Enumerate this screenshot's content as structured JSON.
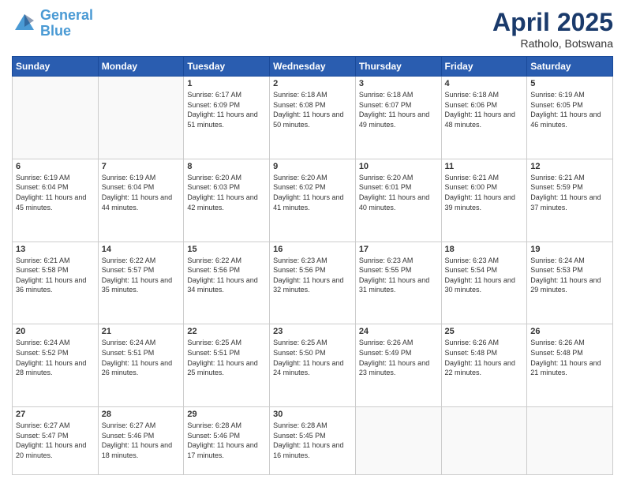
{
  "logo": {
    "line1": "General",
    "line2": "Blue"
  },
  "title": "April 2025",
  "subtitle": "Ratholo, Botswana",
  "days_header": [
    "Sunday",
    "Monday",
    "Tuesday",
    "Wednesday",
    "Thursday",
    "Friday",
    "Saturday"
  ],
  "weeks": [
    [
      {
        "day": "",
        "info": ""
      },
      {
        "day": "",
        "info": ""
      },
      {
        "day": "1",
        "info": "Sunrise: 6:17 AM\nSunset: 6:09 PM\nDaylight: 11 hours and 51 minutes."
      },
      {
        "day": "2",
        "info": "Sunrise: 6:18 AM\nSunset: 6:08 PM\nDaylight: 11 hours and 50 minutes."
      },
      {
        "day": "3",
        "info": "Sunrise: 6:18 AM\nSunset: 6:07 PM\nDaylight: 11 hours and 49 minutes."
      },
      {
        "day": "4",
        "info": "Sunrise: 6:18 AM\nSunset: 6:06 PM\nDaylight: 11 hours and 48 minutes."
      },
      {
        "day": "5",
        "info": "Sunrise: 6:19 AM\nSunset: 6:05 PM\nDaylight: 11 hours and 46 minutes."
      }
    ],
    [
      {
        "day": "6",
        "info": "Sunrise: 6:19 AM\nSunset: 6:04 PM\nDaylight: 11 hours and 45 minutes."
      },
      {
        "day": "7",
        "info": "Sunrise: 6:19 AM\nSunset: 6:04 PM\nDaylight: 11 hours and 44 minutes."
      },
      {
        "day": "8",
        "info": "Sunrise: 6:20 AM\nSunset: 6:03 PM\nDaylight: 11 hours and 42 minutes."
      },
      {
        "day": "9",
        "info": "Sunrise: 6:20 AM\nSunset: 6:02 PM\nDaylight: 11 hours and 41 minutes."
      },
      {
        "day": "10",
        "info": "Sunrise: 6:20 AM\nSunset: 6:01 PM\nDaylight: 11 hours and 40 minutes."
      },
      {
        "day": "11",
        "info": "Sunrise: 6:21 AM\nSunset: 6:00 PM\nDaylight: 11 hours and 39 minutes."
      },
      {
        "day": "12",
        "info": "Sunrise: 6:21 AM\nSunset: 5:59 PM\nDaylight: 11 hours and 37 minutes."
      }
    ],
    [
      {
        "day": "13",
        "info": "Sunrise: 6:21 AM\nSunset: 5:58 PM\nDaylight: 11 hours and 36 minutes."
      },
      {
        "day": "14",
        "info": "Sunrise: 6:22 AM\nSunset: 5:57 PM\nDaylight: 11 hours and 35 minutes."
      },
      {
        "day": "15",
        "info": "Sunrise: 6:22 AM\nSunset: 5:56 PM\nDaylight: 11 hours and 34 minutes."
      },
      {
        "day": "16",
        "info": "Sunrise: 6:23 AM\nSunset: 5:56 PM\nDaylight: 11 hours and 32 minutes."
      },
      {
        "day": "17",
        "info": "Sunrise: 6:23 AM\nSunset: 5:55 PM\nDaylight: 11 hours and 31 minutes."
      },
      {
        "day": "18",
        "info": "Sunrise: 6:23 AM\nSunset: 5:54 PM\nDaylight: 11 hours and 30 minutes."
      },
      {
        "day": "19",
        "info": "Sunrise: 6:24 AM\nSunset: 5:53 PM\nDaylight: 11 hours and 29 minutes."
      }
    ],
    [
      {
        "day": "20",
        "info": "Sunrise: 6:24 AM\nSunset: 5:52 PM\nDaylight: 11 hours and 28 minutes."
      },
      {
        "day": "21",
        "info": "Sunrise: 6:24 AM\nSunset: 5:51 PM\nDaylight: 11 hours and 26 minutes."
      },
      {
        "day": "22",
        "info": "Sunrise: 6:25 AM\nSunset: 5:51 PM\nDaylight: 11 hours and 25 minutes."
      },
      {
        "day": "23",
        "info": "Sunrise: 6:25 AM\nSunset: 5:50 PM\nDaylight: 11 hours and 24 minutes."
      },
      {
        "day": "24",
        "info": "Sunrise: 6:26 AM\nSunset: 5:49 PM\nDaylight: 11 hours and 23 minutes."
      },
      {
        "day": "25",
        "info": "Sunrise: 6:26 AM\nSunset: 5:48 PM\nDaylight: 11 hours and 22 minutes."
      },
      {
        "day": "26",
        "info": "Sunrise: 6:26 AM\nSunset: 5:48 PM\nDaylight: 11 hours and 21 minutes."
      }
    ],
    [
      {
        "day": "27",
        "info": "Sunrise: 6:27 AM\nSunset: 5:47 PM\nDaylight: 11 hours and 20 minutes."
      },
      {
        "day": "28",
        "info": "Sunrise: 6:27 AM\nSunset: 5:46 PM\nDaylight: 11 hours and 18 minutes."
      },
      {
        "day": "29",
        "info": "Sunrise: 6:28 AM\nSunset: 5:46 PM\nDaylight: 11 hours and 17 minutes."
      },
      {
        "day": "30",
        "info": "Sunrise: 6:28 AM\nSunset: 5:45 PM\nDaylight: 11 hours and 16 minutes."
      },
      {
        "day": "",
        "info": ""
      },
      {
        "day": "",
        "info": ""
      },
      {
        "day": "",
        "info": ""
      }
    ]
  ]
}
